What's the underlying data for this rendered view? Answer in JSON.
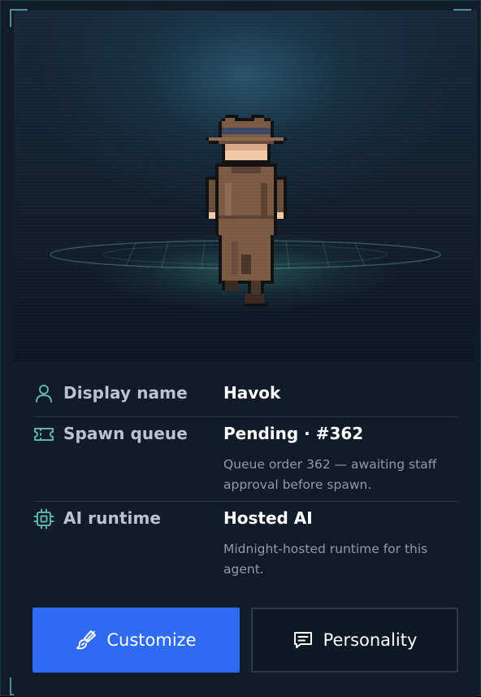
{
  "agent": {
    "avatar": "pixel-detective-sprite"
  },
  "details": [
    {
      "icon": "user-icon",
      "label": "Display name",
      "value": "Havok",
      "note": ""
    },
    {
      "icon": "ticket-icon",
      "label": "Spawn queue",
      "value": "Pending · #362",
      "note": "Queue order 362 — awaiting staff approval before spawn."
    },
    {
      "icon": "cpu-chip-icon",
      "label": "AI runtime",
      "value": "Hosted AI",
      "note": "Midnight-hosted runtime for this agent."
    }
  ],
  "actions": {
    "customize": {
      "label": "Customize",
      "icon": "paintbrush-icon",
      "color": "#2f6af3"
    },
    "personality": {
      "label": "Personality",
      "icon": "chat-bubble-icon"
    }
  },
  "colors": {
    "accent_teal": "#5fb3a8",
    "primary_blue": "#2f6af3",
    "panel": "#121c29"
  }
}
